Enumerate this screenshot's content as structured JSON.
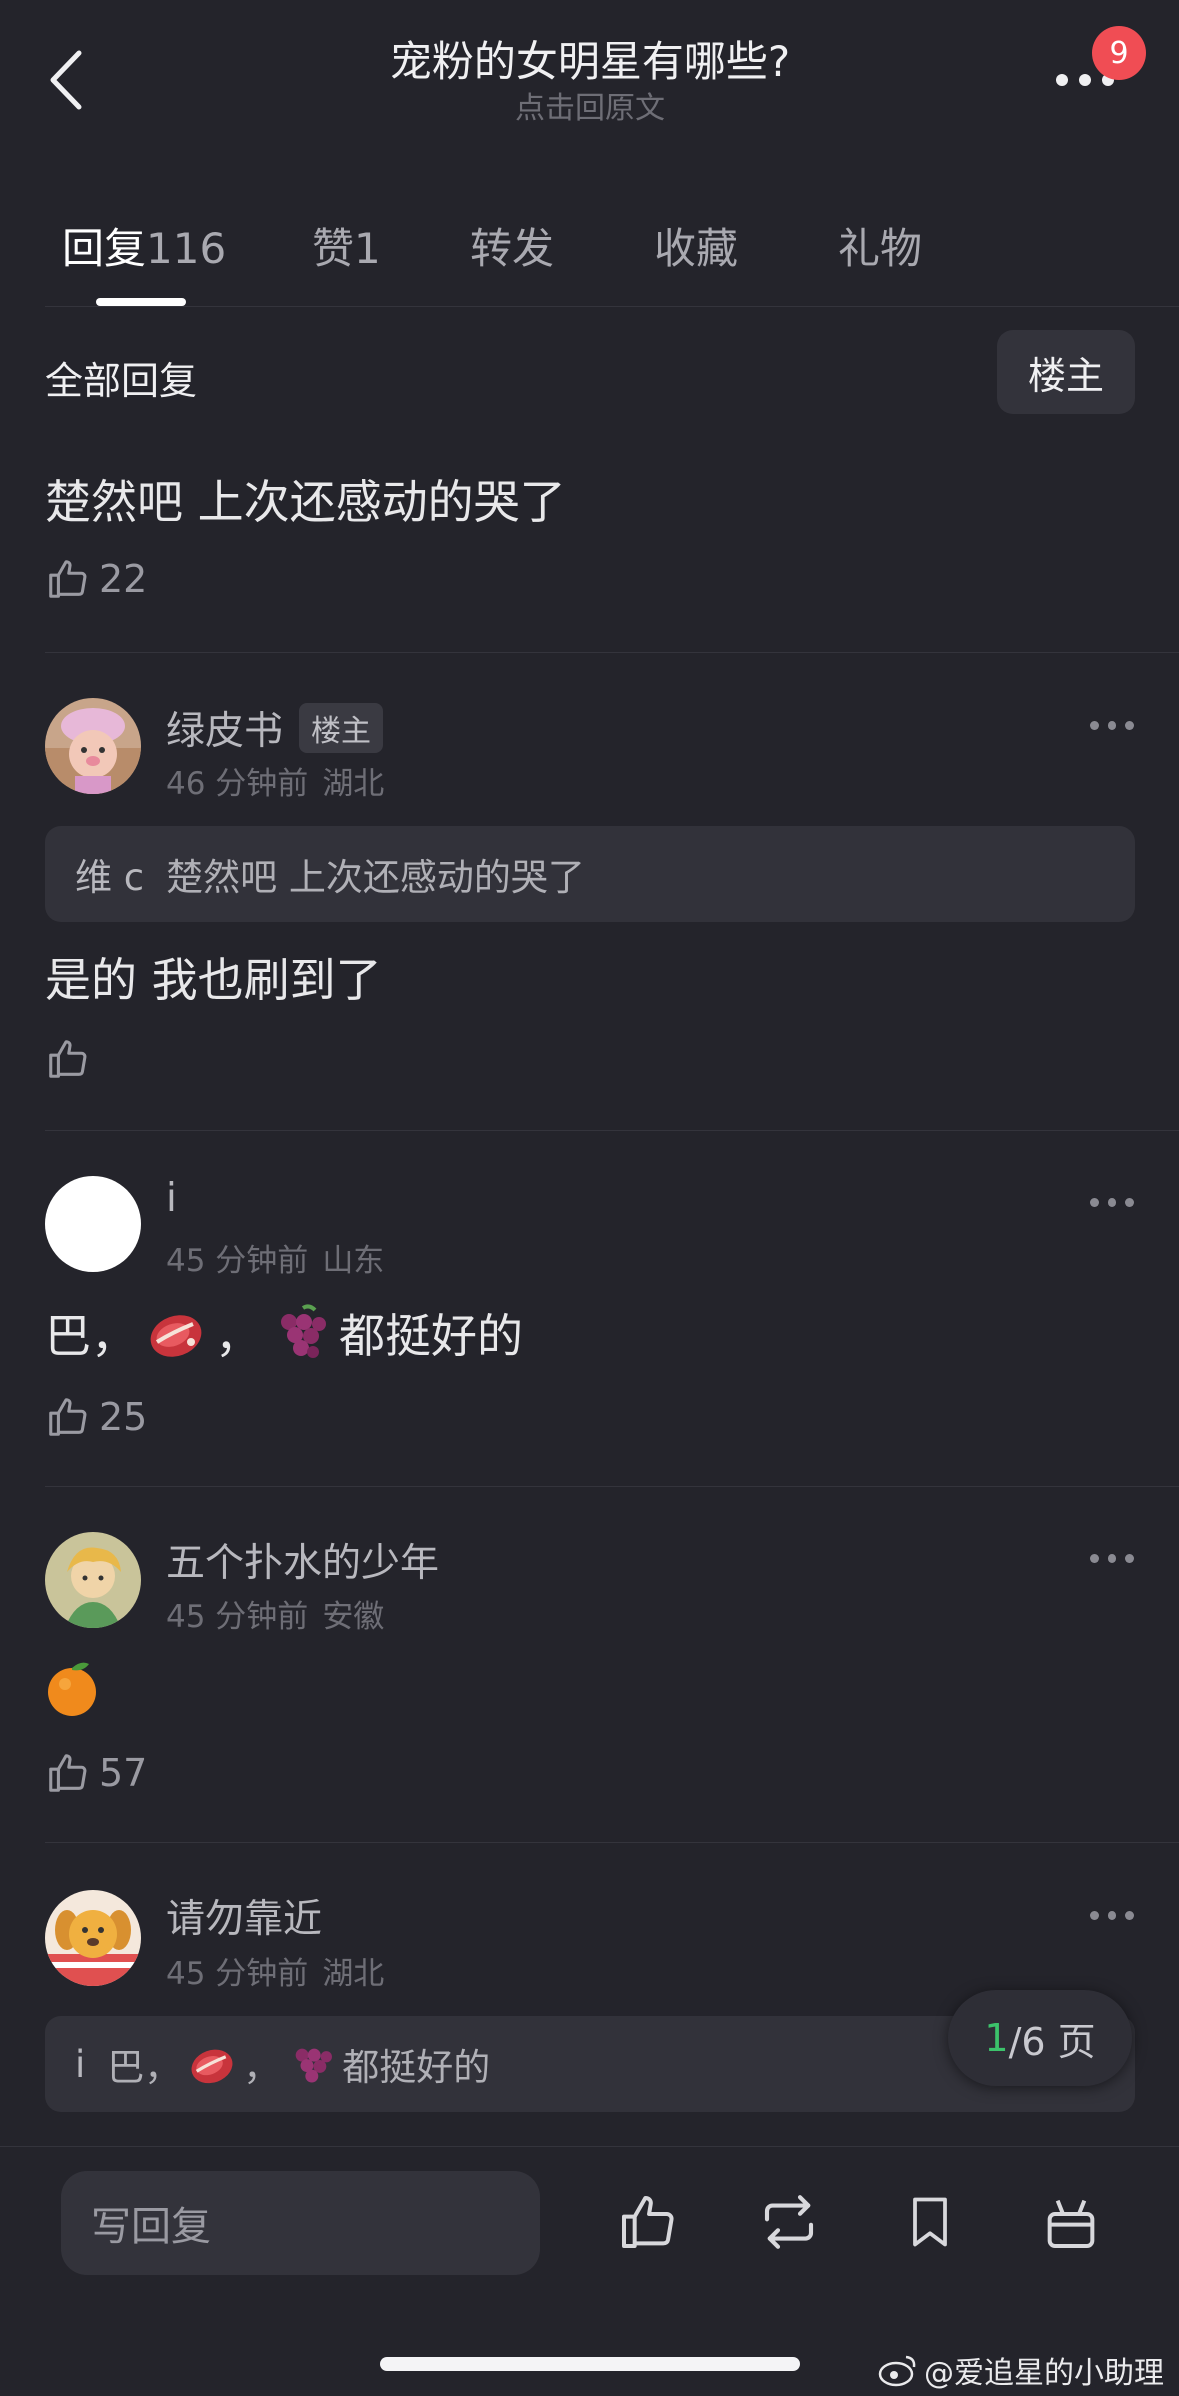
{
  "header": {
    "title": "宠粉的女明星有哪些?",
    "subtitle": "点击回原文",
    "notification_count": "9"
  },
  "tabs": [
    {
      "label": "回复",
      "count": "116",
      "active": true
    },
    {
      "label": "赞",
      "count": "1",
      "active": false
    },
    {
      "label": "转发",
      "count": "",
      "active": false
    },
    {
      "label": "收藏",
      "count": "",
      "active": false
    },
    {
      "label": "礼物",
      "count": "",
      "active": false
    }
  ],
  "filter": {
    "title": "全部回复",
    "op_only_button": "楼主"
  },
  "root_comment": {
    "text": "楚然吧 上次还感动的哭了",
    "likes": "22"
  },
  "comments": [
    {
      "username": "绿皮书",
      "op_tag": "楼主",
      "time": "46 分钟前",
      "location": "湖北",
      "quote_user": "维 c",
      "quote_text": "楚然吧 上次还感动的哭了",
      "text": "是的 我也刷到了",
      "likes": ""
    },
    {
      "username": "i",
      "time": "45 分钟前",
      "location": "山东",
      "text_parts": [
        "巴，",
        "，",
        "都挺好的"
      ],
      "emojis": [
        "meat-emoji",
        "grapes-emoji"
      ],
      "likes": "25"
    },
    {
      "username": "五个扑水的少年",
      "time": "45 分钟前",
      "location": "安徽",
      "emoji": "orange-emoji",
      "likes": "57"
    },
    {
      "username": "请勿靠近",
      "time": "45 分钟前",
      "location": "湖北",
      "quote_user": "i",
      "quote_parts": [
        "巴，",
        "，",
        "都挺好的"
      ]
    }
  ],
  "pagination": {
    "current": "1",
    "total_text": "/6 页"
  },
  "bottom_bar": {
    "reply_placeholder": "写回复",
    "icons": [
      "like-icon",
      "repost-icon",
      "bookmark-icon",
      "gift-icon"
    ]
  },
  "watermark": "@爱追星的小助理",
  "colors": {
    "background": "#24242b",
    "badge": "#f04d54",
    "page_current": "#3cc26b"
  }
}
